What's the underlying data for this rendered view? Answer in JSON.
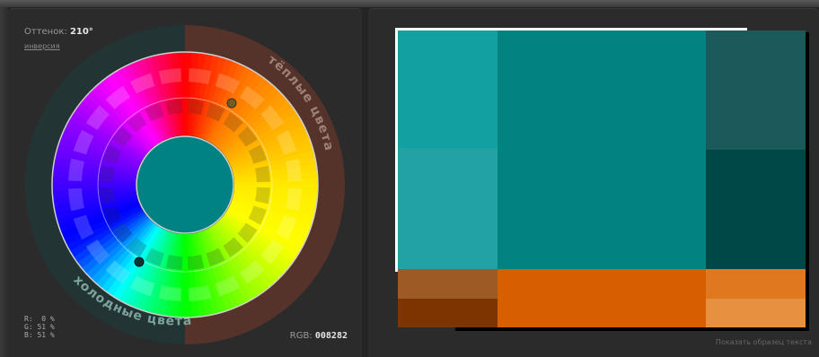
{
  "hue": {
    "label": "Оттенок:",
    "value": "210°"
  },
  "invert_link": "инверсия",
  "ring": {
    "warm": "тёплые цвета",
    "cold": "холодные цвета"
  },
  "rgb_percent": {
    "r": "R:  0 %",
    "g": "G: 51 %",
    "b": "B: 51 %"
  },
  "rgb_hex": {
    "label": "RGB:",
    "value": "008282"
  },
  "center_color": "#008282",
  "show_sample": "Показать образец текста",
  "swatch_colors": {
    "main": "#038282",
    "light1": "#12A0A0",
    "light2": "#22A2A2",
    "dark1": "#1B5A5A",
    "dark2": "#004848",
    "orange": "#D66000",
    "orange_brown1": "#9E5A24",
    "orange_brown2": "#7C3400",
    "orange_light1": "#E07820",
    "orange_light2": "#E69040"
  }
}
